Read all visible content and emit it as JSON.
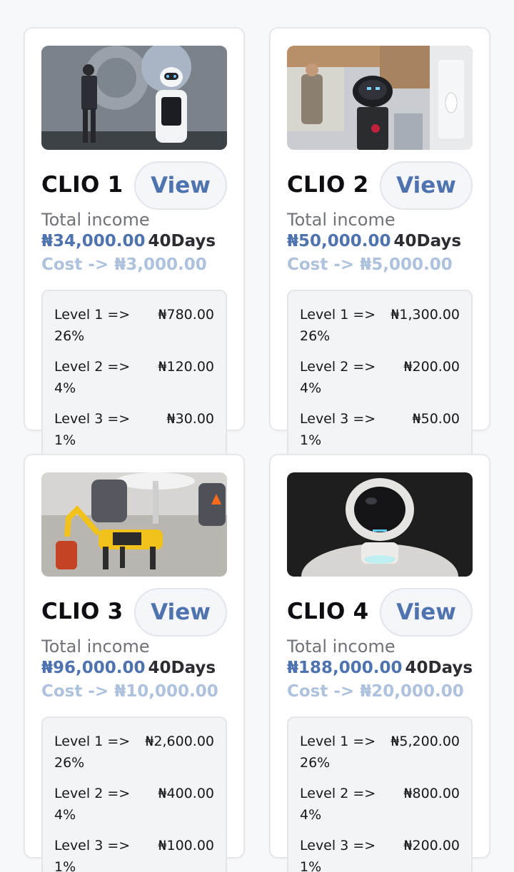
{
  "colors": {
    "accent": "#4e73ae",
    "cost": "#aec2dd",
    "card_border": "#e6e8ec",
    "levels_bg": "#f3f4f6"
  },
  "products": [
    {
      "name": "CLIO 1",
      "view_label": "View",
      "income_label": "Total income",
      "income": "₦34,000.00",
      "duration": "40Days",
      "cost": "Cost -> ₦3,000.00",
      "image": "speaker-with-robot-on-stage",
      "levels": [
        {
          "label": "Level 1 => 26%",
          "value": "₦780.00"
        },
        {
          "label": "Level 2 => 4%",
          "value": "₦120.00"
        },
        {
          "label": "Level 3 => 1%",
          "value": "₦30.00"
        }
      ]
    },
    {
      "name": "CLIO 2",
      "view_label": "View",
      "income_label": "Total income",
      "income": "₦50,000.00",
      "duration": "40Days",
      "cost": "Cost -> ₦5,000.00",
      "image": "robot-at-expo-booth",
      "levels": [
        {
          "label": "Level 1 => 26%",
          "value": "₦1,300.00"
        },
        {
          "label": "Level 2 => 4%",
          "value": "₦200.00"
        },
        {
          "label": "Level 3 => 1%",
          "value": "₦50.00"
        }
      ]
    },
    {
      "name": "CLIO 3",
      "view_label": "View",
      "income_label": "Total income",
      "income": "₦96,000.00",
      "duration": "40Days",
      "cost": "Cost -> ₦10,000.00",
      "image": "yellow-robot-dog",
      "levels": [
        {
          "label": "Level 1 => 26%",
          "value": "₦2,600.00"
        },
        {
          "label": "Level 2 => 4%",
          "value": "₦400.00"
        },
        {
          "label": "Level 3 => 1%",
          "value": "₦100.00"
        }
      ]
    },
    {
      "name": "CLIO 4",
      "view_label": "View",
      "income_label": "Total income",
      "income": "₦188,000.00",
      "duration": "40Days",
      "cost": "Cost -> ₦20,000.00",
      "image": "white-humanoid-robot",
      "levels": [
        {
          "label": "Level 1 => 26%",
          "value": "₦5,200.00"
        },
        {
          "label": "Level 2 => 4%",
          "value": "₦800.00"
        },
        {
          "label": "Level 3 => 1%",
          "value": "₦200.00"
        }
      ]
    }
  ]
}
